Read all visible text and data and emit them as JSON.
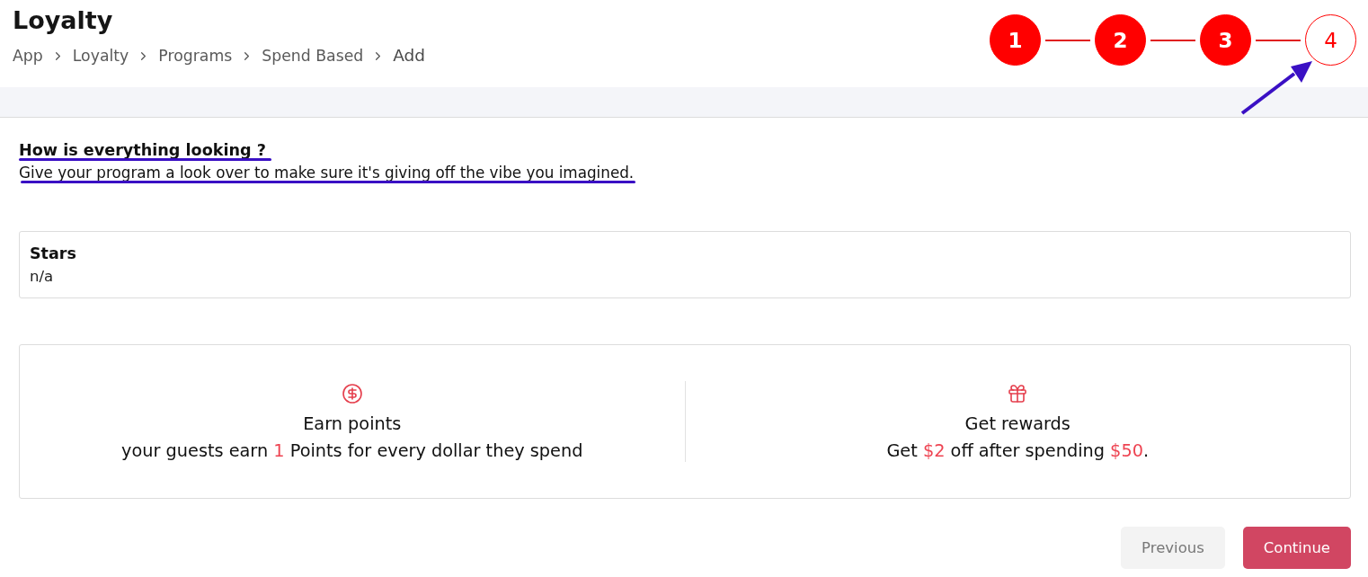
{
  "header": {
    "title": "Loyalty",
    "breadcrumb": [
      "App",
      "Loyalty",
      "Programs",
      "Spend Based",
      "Add"
    ]
  },
  "stepper": {
    "steps": [
      {
        "label": "1",
        "completed": true
      },
      {
        "label": "2",
        "completed": true
      },
      {
        "label": "3",
        "completed": true
      },
      {
        "label": "4",
        "completed": false
      }
    ]
  },
  "review": {
    "heading": "How is everything looking ?",
    "subheading": "Give your program a look over to make sure it's giving off the vibe you imagined."
  },
  "field": {
    "label": "Stars",
    "value": "n/a"
  },
  "summary": [
    {
      "kind": "earn",
      "title": "Earn points",
      "description": [
        {
          "text": "your guests earn ",
          "highlight": false
        },
        {
          "text": "1",
          "highlight": true
        },
        {
          "text": " Points for every dollar they spend",
          "highlight": false
        }
      ]
    },
    {
      "kind": "reward",
      "title": "Get rewards",
      "description": [
        {
          "text": "Get ",
          "highlight": false
        },
        {
          "text": "$2",
          "highlight": true
        },
        {
          "text": " off after spending ",
          "highlight": false
        },
        {
          "text": "$50",
          "highlight": true
        },
        {
          "text": ".",
          "highlight": false
        }
      ]
    }
  ],
  "buttons": [
    {
      "kind": "secondary",
      "label": "Previous"
    },
    {
      "kind": "primary",
      "label": "Continue"
    }
  ]
}
